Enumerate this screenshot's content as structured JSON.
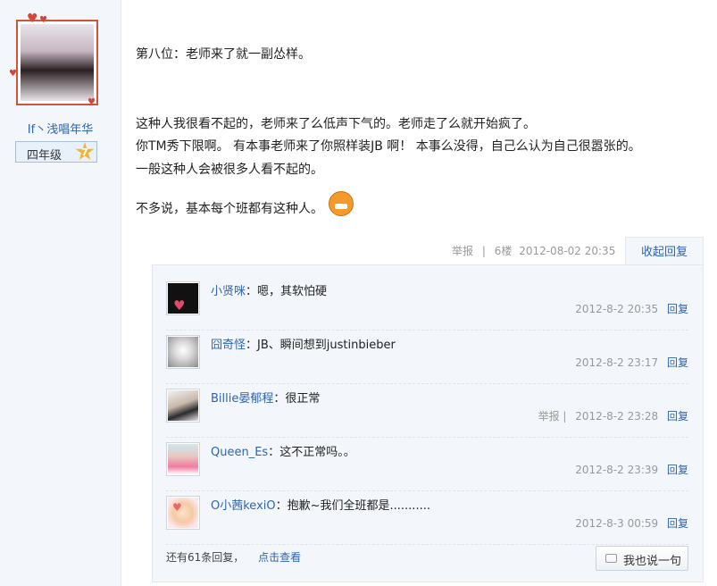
{
  "author": {
    "username": "If丶浅唱年华",
    "grade_label": "四年级",
    "grade_level": "7"
  },
  "post": {
    "lines": [
      "第八位：老师来了就一副怂样。",
      "这种人我很看不起的，老师来了么低声下气的。老师走了么就开始疯了。",
      "你TM秀下限啊。  有本事老师来了你照样装JB 啊！  本事么没得，自己么认为自己很嚣张的。",
      "一般这种人会被很多人看不起的。",
      "不多说，基本每个班都有这种人。"
    ],
    "emoji_icon": "angry-face-icon"
  },
  "post_meta": {
    "report": "举报",
    "separator": "|",
    "floor": "6楼",
    "time": "2012-08-02 20:35"
  },
  "collapse_reply_label": "收起回复",
  "replies": [
    {
      "name": "小贤咪",
      "colon": "：",
      "text": "嗯，其软怕硬",
      "time": "2012-8-2 20:35",
      "report": "",
      "action": "回复"
    },
    {
      "name": "囧奇怪",
      "colon": "：",
      "text": "JB、瞬间想到justinbieber",
      "time": "2012-8-2 23:17",
      "report": "",
      "action": "回复"
    },
    {
      "name": "Billie晏郁程",
      "colon": "：",
      "text": "很正常",
      "time": "2012-8-2 23:28",
      "report": "举报  |",
      "action": "回复"
    },
    {
      "name": "Queen_Es",
      "colon": "：",
      "text": "这不正常吗。。",
      "time": "2012-8-2 23:39",
      "report": "",
      "action": "回复"
    },
    {
      "name": "O小茜kexiO",
      "colon": "：",
      "text": "抱歉~我们全班都是...........",
      "time": "2012-8-3 00:59",
      "report": "",
      "action": "回复"
    }
  ],
  "more_replies": {
    "text": "还有61条回复，",
    "link": "点击查看"
  },
  "say_button": "我也说一句",
  "colors": {
    "link": "#2d64b3",
    "meta": "#999999",
    "panel_bg": "#f3f6fa"
  }
}
